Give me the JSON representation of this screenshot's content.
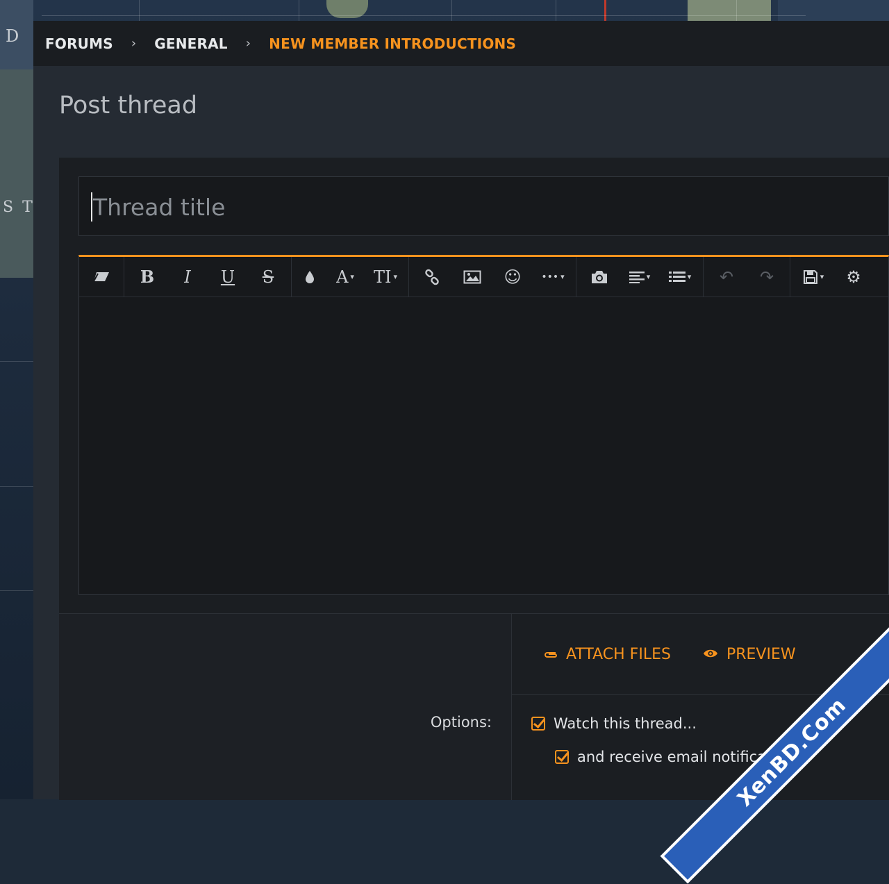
{
  "breadcrumb": {
    "items": [
      "FORUMS",
      "GENERAL",
      "NEW MEMBER INTRODUCTIONS"
    ],
    "separator": "›"
  },
  "page_title": "Post thread",
  "title_field": {
    "placeholder": "Thread title",
    "value": ""
  },
  "toolbar": {
    "icons": [
      "eraser-icon",
      "bold-icon",
      "italic-icon",
      "underline-icon",
      "strikethrough-icon",
      "text-color-icon",
      "font-family-icon",
      "font-size-icon",
      "link-icon",
      "image-icon",
      "smilie-icon",
      "more-icon",
      "media-icon",
      "align-icon",
      "list-icon",
      "undo-icon",
      "redo-icon",
      "drafts-icon",
      "settings-icon"
    ],
    "glyphs": {
      "eraser": "▱",
      "bold": "B",
      "italic": "I",
      "underline": "U",
      "strike": "S",
      "color": "●",
      "font": "A",
      "size": "TI",
      "link": "⛓",
      "image": "▣",
      "smilie": "☺",
      "more": "•••",
      "media": "◉",
      "align": "≡",
      "list": "☰",
      "undo": "↶",
      "redo": "↷",
      "drafts": "▤",
      "settings": "⚙",
      "caret": "▾"
    }
  },
  "actions": {
    "attach": "ATTACH FILES",
    "preview": "PREVIEW"
  },
  "options": {
    "label": "Options:",
    "watch": "Watch this thread...",
    "email": "and receive email notificati"
  },
  "watermark": "XenBD.Com",
  "backdrop": {
    "map_letters": "S T",
    "map_d": "D"
  },
  "colors": {
    "accent": "#f7931e",
    "panel": "#252b33",
    "editor": "#17191c",
    "crumbbar": "#1a1d21"
  }
}
